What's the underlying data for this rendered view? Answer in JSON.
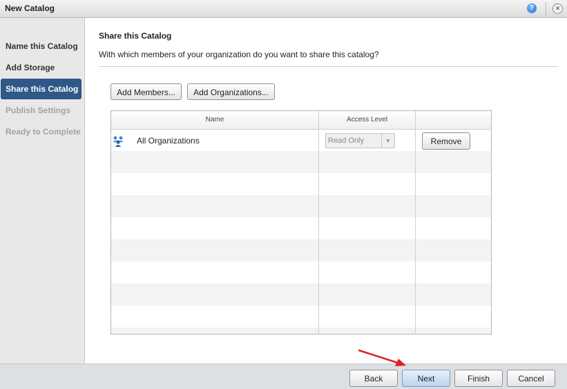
{
  "window": {
    "title": "New Catalog",
    "help_glyph": "?",
    "close_glyph": "✕"
  },
  "sidebar": {
    "steps": [
      {
        "label": "Name this Catalog",
        "state": "done"
      },
      {
        "label": "Add Storage",
        "state": "done"
      },
      {
        "label": "Share this Catalog",
        "state": "active"
      },
      {
        "label": "Publish Settings",
        "state": "disabled"
      },
      {
        "label": "Ready to Complete",
        "state": "disabled"
      }
    ]
  },
  "main": {
    "title": "Share this Catalog",
    "description": "With which members of your organization do you want to share this catalog?",
    "add_members_label": "Add Members...",
    "add_organizations_label": "Add Organizations...",
    "grid": {
      "headers": [
        "Name",
        "Access Level",
        ""
      ],
      "rows": [
        {
          "icon": "organizations-icon",
          "name": "All Organizations",
          "access_level": "Read Only",
          "action_label": "Remove"
        }
      ]
    }
  },
  "footer": {
    "back_label": "Back",
    "next_label": "Next",
    "finish_label": "Finish",
    "cancel_label": "Cancel"
  },
  "colors": {
    "active_step_bg": "#2f5788",
    "annotation_arrow": "#e02020",
    "org_icon": "#2f7fd6"
  }
}
